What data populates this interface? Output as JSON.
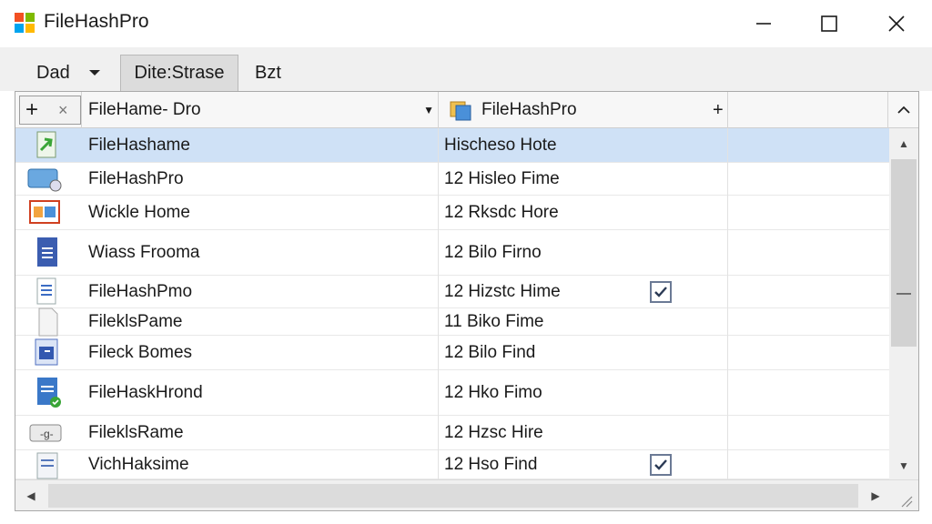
{
  "window": {
    "title": "FileHashPro",
    "logo_colors": [
      "#f25022",
      "#7fba00",
      "#00a4ef",
      "#ffb900"
    ],
    "minimize_label": "—",
    "maximize_label": "☐",
    "close_label": "✕"
  },
  "menubar": {
    "items": [
      {
        "label": "Dad",
        "type": "dropdown"
      },
      {
        "label": "Dite:Strase",
        "type": "tab",
        "active": true
      },
      {
        "label": "Bzt",
        "type": "tab"
      }
    ]
  },
  "table": {
    "columns": [
      {
        "label": "FileHame- Dro",
        "sort_indicator": "▼"
      },
      {
        "label": "FileHashPro",
        "action": "+"
      }
    ],
    "header_add": "+",
    "header_close": "×",
    "collapse_symbol": "⌃",
    "rows": [
      {
        "name": "FileHashame",
        "value": "Hischeso Hote",
        "icon": "green-arrow-file-icon",
        "selected": true,
        "checked": false
      },
      {
        "name": "FileHashPro",
        "value": "12 Hisleo Fime",
        "icon": "drive-folder-icon",
        "selected": false,
        "checked": false
      },
      {
        "name": "Wickle Home",
        "value": "12 Rksdc Hore",
        "icon": "image-folder-icon",
        "selected": false,
        "checked": false
      },
      {
        "name": "Wiass Frooma",
        "value": "12 Bilo Firno",
        "icon": "document-icon",
        "selected": false,
        "checked": false
      },
      {
        "name": "FileHashPmo",
        "value": "12 Hizstc Hime",
        "icon": "text-file-icon",
        "selected": false,
        "checked": true
      },
      {
        "name": "FileklsPame",
        "value": "11 Biko Fime",
        "icon": "blank-file-icon",
        "selected": false,
        "checked": false
      },
      {
        "name": "Fileck Bomes",
        "value": "12 Bilo Find",
        "icon": "blue-app-icon",
        "selected": false,
        "checked": false
      },
      {
        "name": "FileHaskHrond",
        "value": "12 Hko Fimo",
        "icon": "verified-document-icon",
        "selected": false,
        "checked": false
      },
      {
        "name": "FileklsRame",
        "value": "12 Hzsc Hire",
        "icon": "key-badge-icon",
        "selected": false,
        "checked": false
      },
      {
        "name": "VichHaksime",
        "value": "12 Hso Find",
        "icon": "stacked-file-icon",
        "selected": false,
        "checked": true
      }
    ]
  },
  "scrollbar": {
    "vertical_middle": "—",
    "up_arrow": "▲",
    "down_arrow": "▼",
    "left_arrow": "◀",
    "right_arrow": "▶"
  }
}
